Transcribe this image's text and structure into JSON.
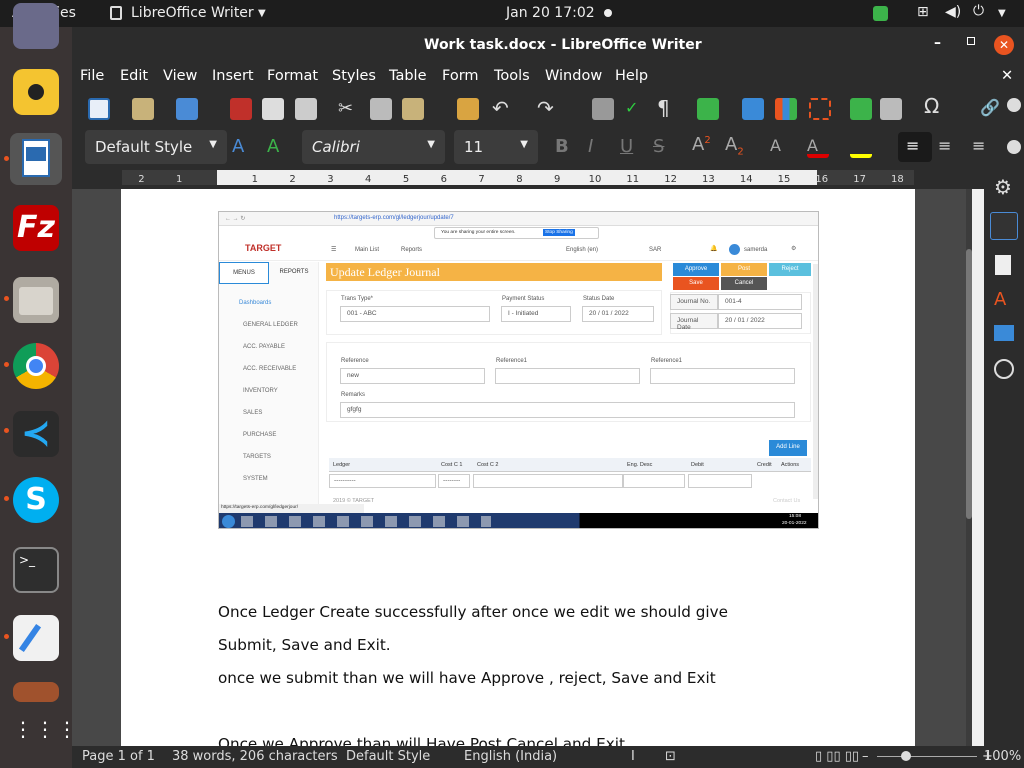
{
  "topbar": {
    "activities": "Activities",
    "app": "LibreOffice Writer",
    "datetime": "Jan 20  17:02"
  },
  "window": {
    "title": "Work task.docx - LibreOffice Writer"
  },
  "menus": [
    "File",
    "Edit",
    "View",
    "Insert",
    "Format",
    "Styles",
    "Table",
    "Form",
    "Tools",
    "Window",
    "Help"
  ],
  "format": {
    "para_style": "Default Style",
    "font_name": "Calibri",
    "font_size": "11"
  },
  "ruler_ticks": [
    "2",
    "1",
    "1",
    "2",
    "3",
    "4",
    "5",
    "6",
    "7",
    "8",
    "9",
    "10",
    "11",
    "12",
    "13",
    "14",
    "15",
    "16",
    "17",
    "18"
  ],
  "embedded": {
    "url": "https://targets-erp.com/gl/ledgerjour/update/7",
    "sharing": "You are sharing your entire screen.",
    "stop_sharing": "Stop Sharing",
    "logo": "TARGET",
    "main_list": "Main List",
    "reports": "Reports",
    "lang": "English (en)",
    "currency": "SAR",
    "user": "samerda",
    "tab_menus": "MENUS",
    "tab_reports": "REPORTS",
    "nav": [
      "Dashboards",
      "GENERAL LEDGER",
      "ACC. PAYABLE",
      "ACC. RECEIVABLE",
      "INVENTORY",
      "SALES",
      "PURCHASE",
      "TARGETS",
      "SYSTEM"
    ],
    "page_title": "Update Ledger Journal",
    "btns": {
      "approve": "Approve",
      "post": "Post",
      "reject": "Reject",
      "save": "Save",
      "cancel": "Cancel"
    },
    "trans_type_label": "Trans Type*",
    "trans_type_value": "001 - ABC",
    "payment_status_label": "Payment Status",
    "payment_status_value": "I - Initiated",
    "status_date_label": "Status Date",
    "status_date_value": "20 / 01 / 2022",
    "journal_no_label": "Journal No.",
    "journal_no_value": "001-4",
    "journal_date_label": "Journal Date",
    "journal_date_value": "20 / 01 / 2022",
    "reference_label": "Reference",
    "reference_value": "new",
    "reference1_label": "Reference1",
    "reference1b_label": "Reference1",
    "remarks_label": "Remarks",
    "remarks_value": "gfgfg",
    "add_line": "Add Line",
    "cols": [
      "Ledger",
      "Cost C 1",
      "Cost C 2",
      "Eng. Desc",
      "Debit",
      "Credit",
      "Actions"
    ],
    "row_dash": "----------",
    "row_dash2": "--------",
    "footer": "2019 © TARGET",
    "contact": "Contact Us",
    "status_url": "https://targets-erp.com/gl/ledgerjour/",
    "clock": "15:08",
    "date": "20-01-2022"
  },
  "doc_lines": [
    "Once Ledger Create successfully after once we edit we should give",
    "Submit, Save  and Exit.",
    "once we submit than we will have Approve , reject, Save and Exit",
    "Once we Approve than will Have Post Cancel and Exit."
  ],
  "status": {
    "page": "Page 1 of 1",
    "words": "38 words, 206 characters",
    "style": "Default Style",
    "lang": "English (India)",
    "zoom": "100%"
  }
}
